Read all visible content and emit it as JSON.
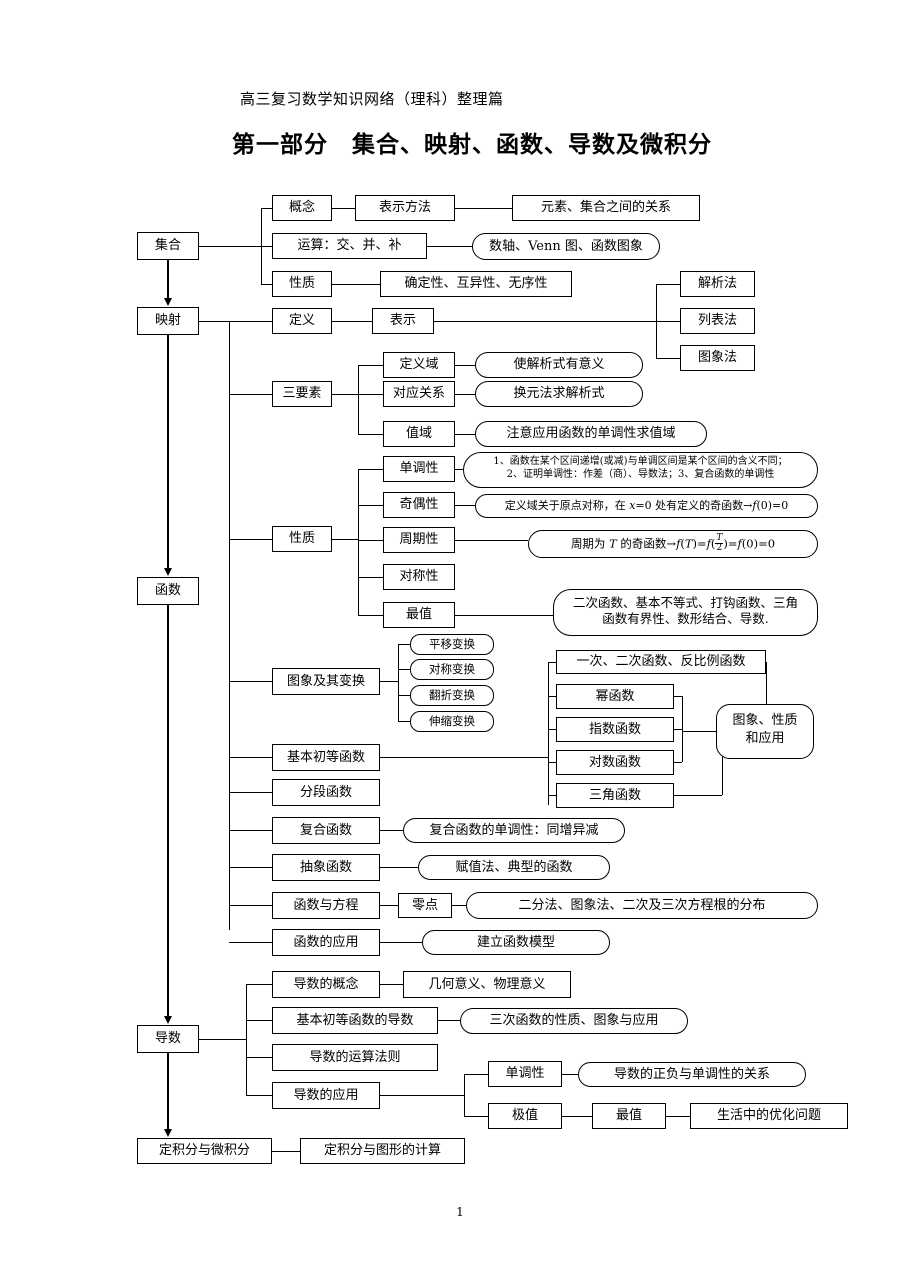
{
  "document": {
    "subtitle": "高三复习数学知识网络（理科）整理篇",
    "main_title": "第一部分　集合、映射、函数、导数及微积分",
    "page_number": "1"
  },
  "spine": {
    "set": "集合",
    "mapping": "映射",
    "function": "函数",
    "derivative": "导数",
    "integral": "定积分与微积分"
  },
  "set_branch": {
    "concept": "概念",
    "concept_detail": "表示方法",
    "concept_detail2": "元素、集合之间的关系",
    "operation": "运算：交、并、补",
    "operation_detail": "数轴、Venn 图、函数图象",
    "property": "性质",
    "property_detail": "确定性、互异性、无序性"
  },
  "mapping_branch": {
    "definition": "定义",
    "representation": "表示",
    "methods": [
      "解析法",
      "列表法",
      "图象法"
    ]
  },
  "function_branch": {
    "three_elements": {
      "label": "三要素",
      "items": [
        {
          "name": "定义域",
          "detail": "使解析式有意义"
        },
        {
          "name": "对应关系",
          "detail": "换元法求解析式"
        },
        {
          "name": "值域",
          "detail": "注意应用函数的单调性求值域"
        }
      ]
    },
    "properties": {
      "label": "性质",
      "items": [
        {
          "name": "单调性",
          "detail_line1": "1、函数在某个区间递增(或减)与单调区间是某个区间的含义不同；",
          "detail_line2": "2、证明单调性：作差（商）、导数法；3、复合函数的单调性"
        },
        {
          "name": "奇偶性",
          "detail": "定义域关于原点对称，在 x=0 处有定义的奇函数→f(0)=0"
        },
        {
          "name": "周期性",
          "detail": "周期为 T 的奇函数→f(T)=f(T/2)=f(0)=0"
        },
        {
          "name": "对称性",
          "detail": ""
        },
        {
          "name": "最值",
          "detail_line1": "二次函数、基本不等式、打钩函数、三角",
          "detail_line2": "函数有界性、数形结合、导数."
        }
      ]
    },
    "graph_transform": {
      "label": "图象及其变换",
      "items": [
        "平移变换",
        "对称变换",
        "翻折变换",
        "伸缩变换"
      ]
    },
    "elementary": {
      "label": "基本初等函数",
      "items": [
        "一次、二次函数、反比例函数",
        "幂函数",
        "指数函数",
        "对数函数",
        "三角函数"
      ],
      "summary": "图象、性质\n和应用"
    },
    "piecewise": "分段函数",
    "composite": {
      "label": "复合函数",
      "detail": "复合函数的单调性：同增异减"
    },
    "abstract": {
      "label": "抽象函数",
      "detail": "赋值法、典型的函数"
    },
    "equation": {
      "label": "函数与方程",
      "mid": "零点",
      "detail": "二分法、图象法、二次及三次方程根的分布"
    },
    "application": {
      "label": "函数的应用",
      "detail": "建立函数模型"
    }
  },
  "derivative_branch": {
    "concept": {
      "label": "导数的概念",
      "detail": "几何意义、物理意义"
    },
    "elementary_derivative": {
      "label": "基本初等函数的导数",
      "detail": "三次函数的性质、图象与应用"
    },
    "rules": "导数的运算法则",
    "application": {
      "label": "导数的应用",
      "monotonic": "单调性",
      "monotonic_detail": "导数的正负与单调性的关系",
      "extremum": "极值",
      "maxmin": "最值",
      "optimize": "生活中的优化问题"
    }
  },
  "integral_branch": {
    "detail": "定积分与图形的计算"
  }
}
